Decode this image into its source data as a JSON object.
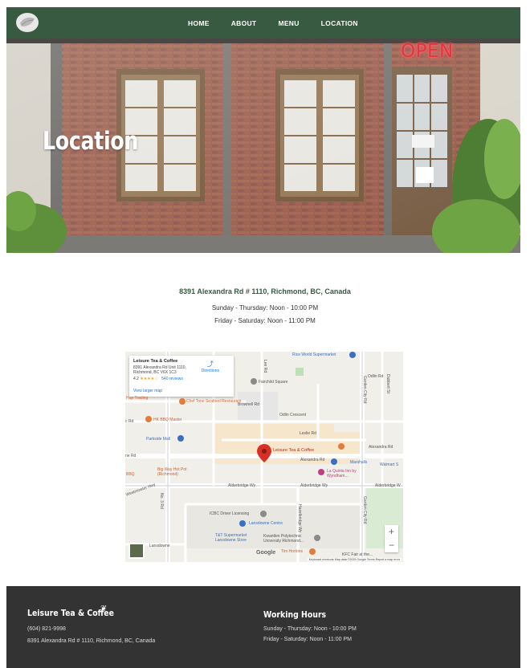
{
  "nav": {
    "logo_icon": "tea-leaf-logo",
    "links": [
      "HOME",
      "ABOUT",
      "MENU",
      "LOCATION"
    ]
  },
  "hero": {
    "title": "Location",
    "sign": "OPEN"
  },
  "info": {
    "address": "8391 Alexandra Rd # 1110, Richmond, BC, Canada",
    "hours_weekday": "Sunday - Thursday: Noon - 10:00 PM",
    "hours_weekend": "Friday - Saturday: Noon - 11:00 PM"
  },
  "map": {
    "card": {
      "name": "Leisure Tea & Coffee",
      "address_line1": "8391 Alexandra Rd Unit 1110,",
      "address_line2": "Richmond, BC V6X 1C3",
      "rating": "4.2",
      "stars": "★★★★☆",
      "reviews": "540 reviews",
      "larger_map": "View larger map",
      "directions": "Directions"
    },
    "labels": {
      "rice_world": "Rice World Supermarket",
      "fairchild": "Fairchild Square",
      "brownell": "Brownell Rd",
      "odlin": "Odlin Crescent",
      "leslie": "Leslie Rd",
      "alexandra": "Alexandra Rd",
      "alexandra_right": "Alexandra Rd",
      "hub": "Hup Trading",
      "chef_tone": "Chef Tone Seafood Restaurant",
      "hk_bbq": "HK BBQ Master",
      "parkside": "Parkside Mall",
      "leisure": "Leisure Tea & Coffee",
      "marshalls": "Marshalls",
      "walmart": "Walmart S",
      "big_way": "Big Way Hot Pot (Richmond)",
      "la_quinta": "La Quinta Inn by Wyndham...",
      "bbq": "BBQ",
      "alderbridge1": "Alderbridge Wy",
      "alderbridge2": "Alderbridge Wy",
      "alderbridge3": "Alderbridge W",
      "icbc": "ICBC Driver Licensing",
      "lansdowne_centre": "Lansdowne Centre",
      "tnt": "T&T Supermarket Lansdowne Store",
      "kwantlen": "Kwantlen Polytechnic University Richmond...",
      "tim": "Tim Hortons",
      "lansdowne": "Lansdowne",
      "no3": "No. 3 Rd",
      "garden_city": "Garden City Rd",
      "garden_city2": "Garden City Rd",
      "hazelbridge": "Hazelbridge Wy",
      "odlin_rd": "Odlin Rd",
      "dubbert": "Dubbert St",
      "lee_rd": "Lee Rd",
      "ne_rd": "ne Rd",
      "c_rd": "c Rd",
      "westminster": "Westminster Hwy",
      "map_data": "Keyboard shortcuts   Map data ©2025 Google   Terms   Report a map error",
      "google": "Google",
      "kfc": "KFC Fair at the..."
    },
    "zoom_in": "+",
    "zoom_out": "−"
  },
  "footer": {
    "brand": "Leisure Tea & Coffee",
    "phone": "(604) 821-9998",
    "address": "8391 Alexandra Rd # 1110, Richmond, BC, Canada",
    "hours_title": "Working Hours",
    "hours_weekday": "Sunday - Thursday: Noon - 10:00 PM",
    "hours_weekend": "Friday - Saturday: Noon - 11:00 PM"
  },
  "colors": {
    "nav_green": "#375a40",
    "footer_dark": "#333333",
    "map_pin": "#d93025"
  }
}
